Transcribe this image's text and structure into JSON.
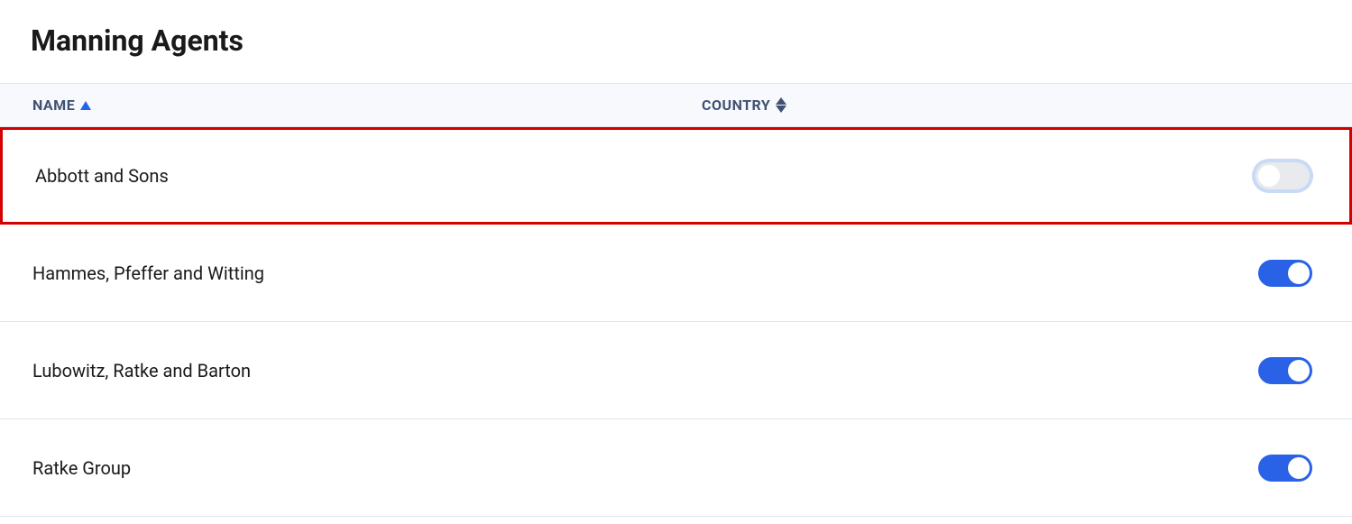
{
  "header": {
    "title": "Manning Agents"
  },
  "table": {
    "columns": {
      "name": "NAME",
      "country": "COUNTRY"
    },
    "rows": [
      {
        "name": "Abbott and Sons",
        "country": "",
        "enabled": false,
        "highlighted": true
      },
      {
        "name": "Hammes, Pfeffer and Witting",
        "country": "",
        "enabled": true,
        "highlighted": false
      },
      {
        "name": "Lubowitz, Ratke and Barton",
        "country": "",
        "enabled": true,
        "highlighted": false
      },
      {
        "name": "Ratke Group",
        "country": "",
        "enabled": true,
        "highlighted": false
      }
    ]
  }
}
